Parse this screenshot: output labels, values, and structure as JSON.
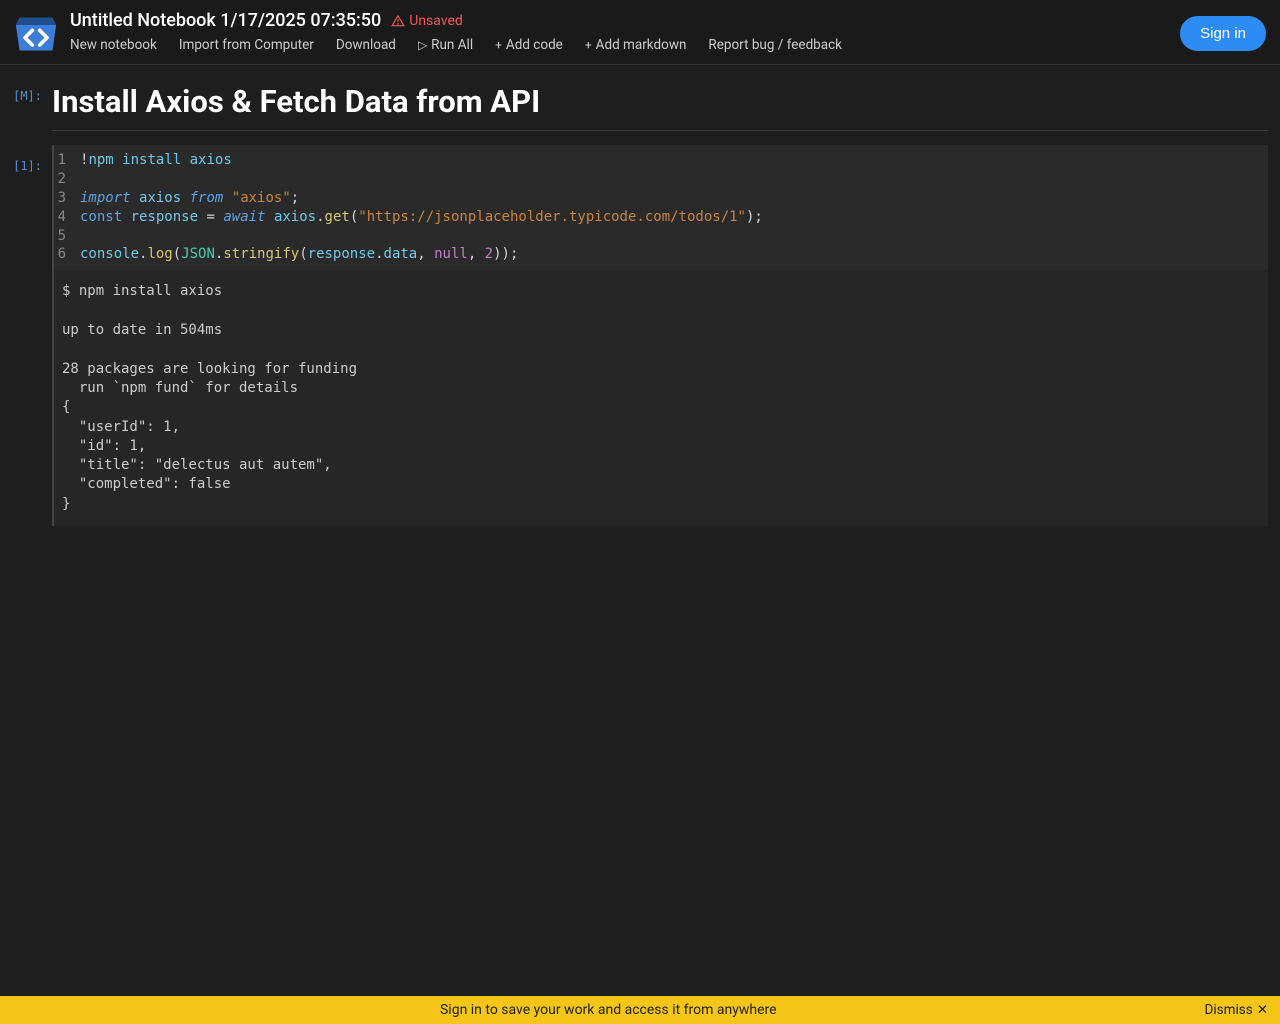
{
  "header": {
    "title": "Untitled Notebook 1/17/2025 07:35:50",
    "unsaved_label": "Unsaved",
    "menu": {
      "new_notebook": "New notebook",
      "import": "Import from Computer",
      "download": "Download",
      "run_all": "Run All",
      "add_code": "Add code",
      "add_markdown": "Add markdown",
      "report": "Report bug / feedback"
    },
    "signin": "Sign in"
  },
  "cells": {
    "md": {
      "gutter": "[M]:",
      "heading": "Install Axios & Fetch Data from API"
    },
    "code": {
      "gutter": "[1]:",
      "lines": [
        {
          "n": "1",
          "tokens": [
            {
              "c": "tok-op",
              "t": "!"
            },
            {
              "c": "tok-var",
              "t": "npm"
            },
            {
              "c": "tok-plain",
              "t": " "
            },
            {
              "c": "tok-var",
              "t": "install"
            },
            {
              "c": "tok-plain",
              "t": " "
            },
            {
              "c": "tok-var",
              "t": "axios"
            }
          ]
        },
        {
          "n": "2",
          "tokens": []
        },
        {
          "n": "3",
          "tokens": [
            {
              "c": "tok-kw",
              "t": "import"
            },
            {
              "c": "tok-plain",
              "t": " "
            },
            {
              "c": "tok-var",
              "t": "axios"
            },
            {
              "c": "tok-plain",
              "t": " "
            },
            {
              "c": "tok-kw",
              "t": "from"
            },
            {
              "c": "tok-plain",
              "t": " "
            },
            {
              "c": "tok-str",
              "t": "\"axios\""
            },
            {
              "c": "tok-op",
              "t": ";"
            }
          ]
        },
        {
          "n": "4",
          "tokens": [
            {
              "c": "tok-kw2",
              "t": "const"
            },
            {
              "c": "tok-plain",
              "t": " "
            },
            {
              "c": "tok-var",
              "t": "response"
            },
            {
              "c": "tok-plain",
              "t": " "
            },
            {
              "c": "tok-op",
              "t": "="
            },
            {
              "c": "tok-plain",
              "t": " "
            },
            {
              "c": "tok-await",
              "t": "await"
            },
            {
              "c": "tok-plain",
              "t": " "
            },
            {
              "c": "tok-var",
              "t": "axios"
            },
            {
              "c": "tok-op",
              "t": "."
            },
            {
              "c": "tok-call",
              "t": "get"
            },
            {
              "c": "tok-op",
              "t": "("
            },
            {
              "c": "tok-str",
              "t": "\"https://jsonplaceholder.typicode.com/todos/1\""
            },
            {
              "c": "tok-op",
              "t": ");"
            }
          ]
        },
        {
          "n": "5",
          "tokens": []
        },
        {
          "n": "6",
          "tokens": [
            {
              "c": "tok-var",
              "t": "console"
            },
            {
              "c": "tok-op",
              "t": "."
            },
            {
              "c": "tok-call",
              "t": "log"
            },
            {
              "c": "tok-op",
              "t": "("
            },
            {
              "c": "tok-obj",
              "t": "JSON"
            },
            {
              "c": "tok-op",
              "t": "."
            },
            {
              "c": "tok-call",
              "t": "stringify"
            },
            {
              "c": "tok-op",
              "t": "("
            },
            {
              "c": "tok-var",
              "t": "response"
            },
            {
              "c": "tok-op",
              "t": "."
            },
            {
              "c": "tok-var",
              "t": "data"
            },
            {
              "c": "tok-op",
              "t": ", "
            },
            {
              "c": "tok-null",
              "t": "null"
            },
            {
              "c": "tok-op",
              "t": ", "
            },
            {
              "c": "tok-num",
              "t": "2"
            },
            {
              "c": "tok-op",
              "t": "));"
            }
          ]
        }
      ],
      "output": "$ npm install axios\n\nup to date in 504ms\n\n28 packages are looking for funding\n  run `npm fund` for details\n{\n  \"userId\": 1,\n  \"id\": 1,\n  \"title\": \"delectus aut autem\",\n  \"completed\": false\n}"
    }
  },
  "banner": {
    "message": "Sign in to save your work and access it from anywhere",
    "dismiss": "Dismiss",
    "close": "✕"
  }
}
